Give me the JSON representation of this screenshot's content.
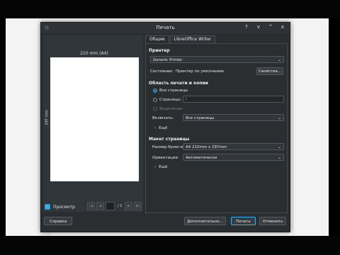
{
  "dialog": {
    "title": "Печать",
    "window_controls": [
      "?",
      "v",
      "^",
      "x"
    ]
  },
  "preview": {
    "page_size_label": "210 mm (A4)",
    "page_height_label": "297 mm",
    "checkbox_label": "Просмотр",
    "checkbox_checked": true,
    "page_total": "/ 1",
    "page_current": ""
  },
  "tabs": [
    {
      "label": "Общие",
      "active": true
    },
    {
      "label": "LibreOffice Writer",
      "active": false
    }
  ],
  "printer": {
    "section_label": "Принтер",
    "selected": "Generic Printer",
    "status_label": "Состояние:",
    "status_value": "Принтер по умолчанию",
    "properties_button": "Свойства..."
  },
  "range": {
    "section_label": "Область печати и копии",
    "all_pages": "Все страницы",
    "pages_label": "Страницы:",
    "pages_value": "1",
    "selection": "Выделение",
    "include_label": "Включать:",
    "include_value": "Все страницы",
    "more": "Ещё"
  },
  "layout": {
    "section_label": "Макет страницы",
    "paper_size_label": "Размер бумаги:",
    "paper_size_value": "A4 210mm x 297mm",
    "orientation_label": "Ориентация:",
    "orientation_value": "Автоматически",
    "more": "Ещё"
  },
  "footer": {
    "help": "Справка",
    "more_options": "Дополнительно...",
    "print": "Печать",
    "cancel": "Отменить"
  },
  "colors": {
    "dialog_bg": "#2b2e31",
    "accent": "#3daee9"
  }
}
